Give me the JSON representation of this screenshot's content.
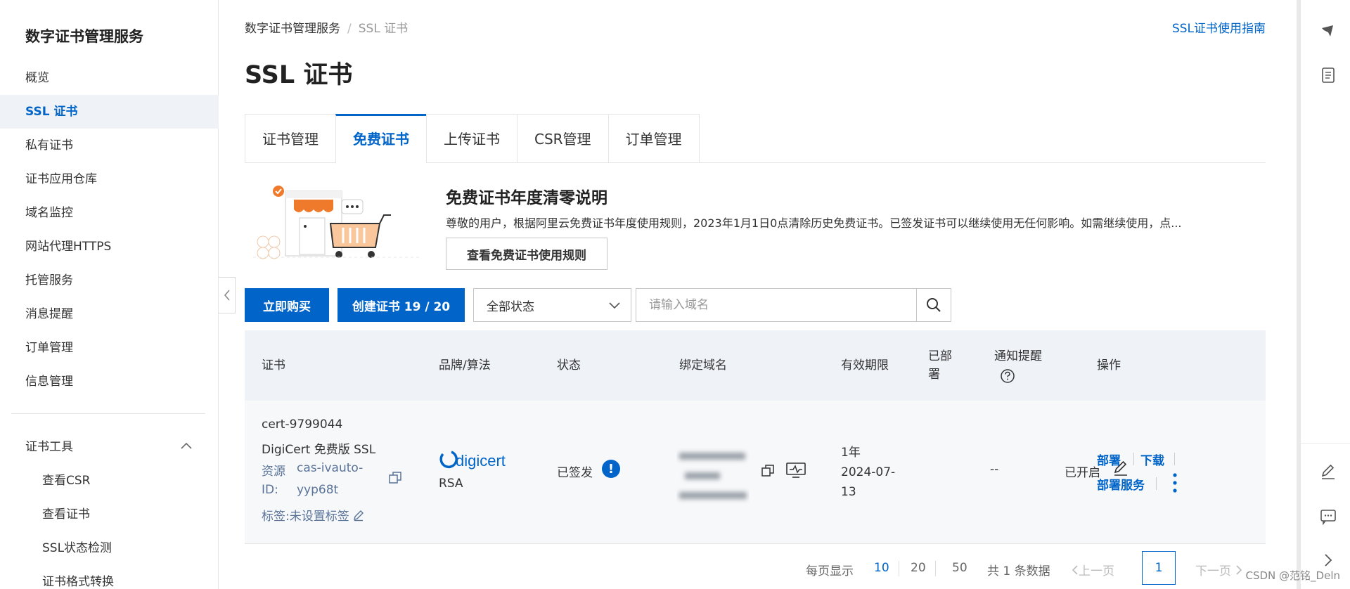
{
  "sidebar": {
    "title": "数字证书管理服务",
    "items": [
      {
        "label": "概览"
      },
      {
        "label": "SSL 证书",
        "active": true
      },
      {
        "label": "私有证书"
      },
      {
        "label": "证书应用仓库"
      },
      {
        "label": "域名监控"
      },
      {
        "label": "网站代理HTTPS"
      },
      {
        "label": "托管服务"
      },
      {
        "label": "消息提醒"
      },
      {
        "label": "订单管理"
      },
      {
        "label": "信息管理"
      }
    ],
    "tools_group": {
      "label": "证书工具",
      "items": [
        {
          "label": "查看CSR"
        },
        {
          "label": "查看证书"
        },
        {
          "label": "SSL状态检测"
        },
        {
          "label": "证书格式转换"
        }
      ]
    }
  },
  "header": {
    "breadcrumb": [
      "数字证书管理服务",
      "SSL 证书"
    ],
    "breadcrumb_sep": "/",
    "guide_link": "SSL证书使用指南",
    "page_title": "SSL 证书"
  },
  "tabs": [
    {
      "label": "证书管理"
    },
    {
      "label": "免费证书",
      "active": true
    },
    {
      "label": "上传证书"
    },
    {
      "label": "CSR管理"
    },
    {
      "label": "订单管理"
    }
  ],
  "notice": {
    "title": "免费证书年度清零说明",
    "text": "尊敬的用户，根据阿里云免费证书年度使用规则，2023年1月1日0点清除历史免费证书。已签发证书可以继续使用无任何影响。如需继续使用，点...",
    "button": "查看免费证书使用规则"
  },
  "toolbar": {
    "buy_button": "立即购买",
    "create_button": "创建证书 19 / 20",
    "status_select": "全部状态",
    "search_placeholder": "请输入域名"
  },
  "table": {
    "headers": {
      "cert": "证书",
      "brand": "品牌/算法",
      "status": "状态",
      "domain": "绑定域名",
      "validity": "有效期限",
      "deployed_line1": "已部",
      "deployed_line2": "署",
      "notify": "通知提醒",
      "ops": "操作"
    },
    "rows": [
      {
        "cert_id": "cert-9799044",
        "cert_name": "DigiCert 免费版 SSL",
        "resource_label_1": "资源",
        "resource_label_2": "ID:",
        "resource_id_1": "cas-ivauto-",
        "resource_id_2": "yyp68t",
        "tag": "标签:未设置标签",
        "brand": "digicert",
        "algo": "RSA",
        "status": "已签发",
        "status_info": "!",
        "validity_1": "1年",
        "validity_2": "2024-07-",
        "validity_3": "13",
        "deployed": "--",
        "notify": "已开启",
        "op_deploy": "部署",
        "op_download": "下载",
        "op_deploy_service": "部署服务"
      }
    ]
  },
  "pagination": {
    "per_page_label": "每页显示",
    "sizes": [
      "10",
      "20",
      "50"
    ],
    "active_size": "10",
    "total": "共 1 条数据",
    "prev": "上一页",
    "current": "1",
    "next": "下一页"
  },
  "watermark": "CSDN @范铭_Deln",
  "colors": {
    "primary": "#0064c8",
    "sidebar_active_bg": "#eff3f8",
    "table_header_bg": "#eff3f8"
  }
}
